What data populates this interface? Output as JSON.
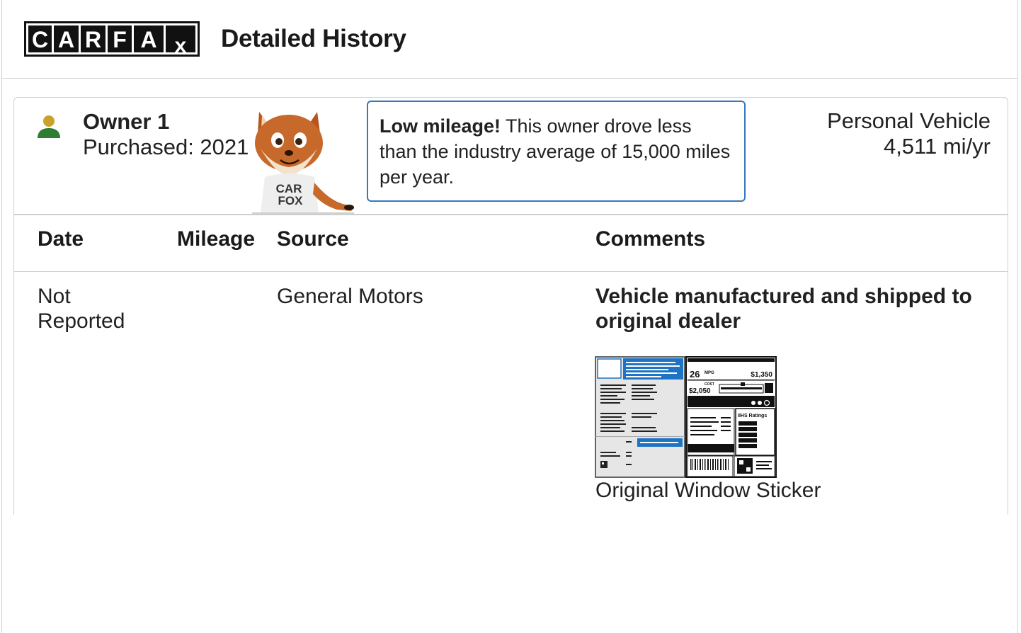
{
  "header": {
    "logo_text": "CARFAX",
    "title": "Detailed History"
  },
  "owner": {
    "name": "Owner 1",
    "purchased": "Purchased: 2021",
    "vehicle_type": "Personal Vehicle",
    "annual_miles": "4,511 mi/yr",
    "mascot_shirt_text": "CAR FOX",
    "icon_color": "#2e7d32",
    "icon_head_color": "#c9a227"
  },
  "mileage_note": {
    "lead": "Low mileage!",
    "body": " This owner drove less than the industry average of 15,000 miles per year.",
    "border_color": "#3777bc"
  },
  "table": {
    "columns": [
      "Date",
      "Mileage",
      "Source",
      "Comments"
    ],
    "rows": [
      {
        "date": "Not Reported",
        "mileage": "",
        "source": "General Motors",
        "comment": "Vehicle manufactured and shipped to original dealer",
        "attachment_label": "Original Window Sticker"
      }
    ]
  },
  "sticker": {
    "mpg": "26",
    "mpg_unit": "MPG",
    "annual_fuel_cost": "$2,050",
    "savings": "$1,350",
    "cost_label": "COST",
    "ratings_title": "IIHS Ratings",
    "accent_color": "#1f73c4"
  }
}
